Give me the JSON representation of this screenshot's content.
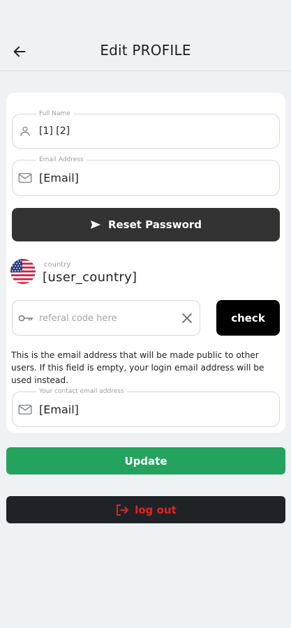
{
  "header": {
    "title": "Edit PROFILE",
    "back_icon": "arrow-left-icon"
  },
  "full_name": {
    "label": "Full Name",
    "value": "[1] [2]",
    "icon": "person-icon"
  },
  "email": {
    "label": "Email Address",
    "value": "[Email]",
    "icon": "mail-icon"
  },
  "reset_password": {
    "label": "Reset Password",
    "icon": "send-icon"
  },
  "country": {
    "label": "country",
    "value": "[user_country]",
    "flag_icon": "us-flag-icon"
  },
  "referral": {
    "placeholder": "referal code here",
    "value": "",
    "icon": "key-icon",
    "clear_icon": "close-icon",
    "check_label": "check"
  },
  "contact_info": {
    "description": "This is the email address that will be made public to other users. If this field is empty, your login email address will be used instead.",
    "label": "Your contact email address",
    "value": "[Email]",
    "icon": "mail-icon"
  },
  "actions": {
    "update_label": "Update",
    "logout_label": "log out",
    "logout_icon": "logout-icon"
  },
  "colors": {
    "background": "#eff2f5",
    "card": "#ffffff",
    "reset_button": "#333333",
    "check_button": "#000000",
    "update_button": "#24a35e",
    "logout_button": "#1f2328",
    "logout_text": "#e02424"
  }
}
